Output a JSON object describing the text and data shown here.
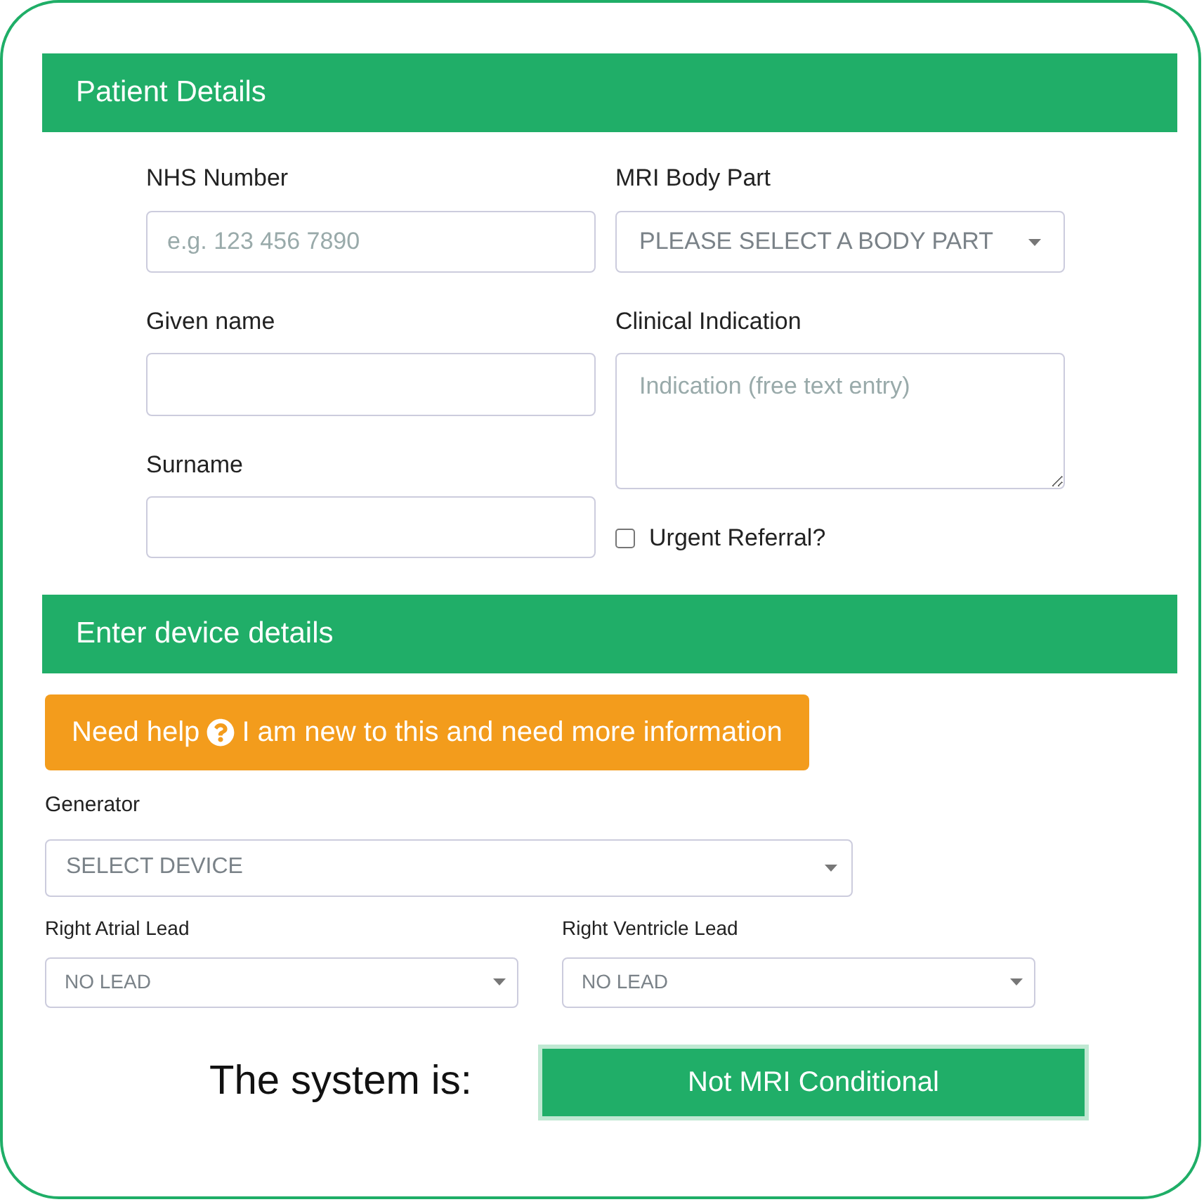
{
  "patient_details": {
    "title": "Patient Details",
    "nhs_number": {
      "label": "NHS Number",
      "placeholder": "e.g. 123 456 7890"
    },
    "given_name": {
      "label": "Given name"
    },
    "surname": {
      "label": "Surname"
    },
    "mri_body_part": {
      "label": "MRI Body Part",
      "value": "PLEASE SELECT A BODY PART"
    },
    "clinical_indication": {
      "label": "Clinical Indication",
      "placeholder": "Indication (free text entry)"
    },
    "urgent_referral": {
      "label": "Urgent Referral?",
      "checked": false
    }
  },
  "device_details": {
    "title": "Enter device details",
    "help_button": {
      "before": "Need help",
      "after": "I am new to this and need more information"
    },
    "generator": {
      "label": "Generator",
      "value": "SELECT DEVICE"
    },
    "right_atrial_lead": {
      "label": "Right Atrial Lead",
      "value": "NO LEAD"
    },
    "right_ventricle_lead": {
      "label": "Right Ventricle Lead",
      "value": "NO LEAD"
    }
  },
  "result": {
    "label": "The system is:",
    "value": "Not MRI Conditional"
  }
}
